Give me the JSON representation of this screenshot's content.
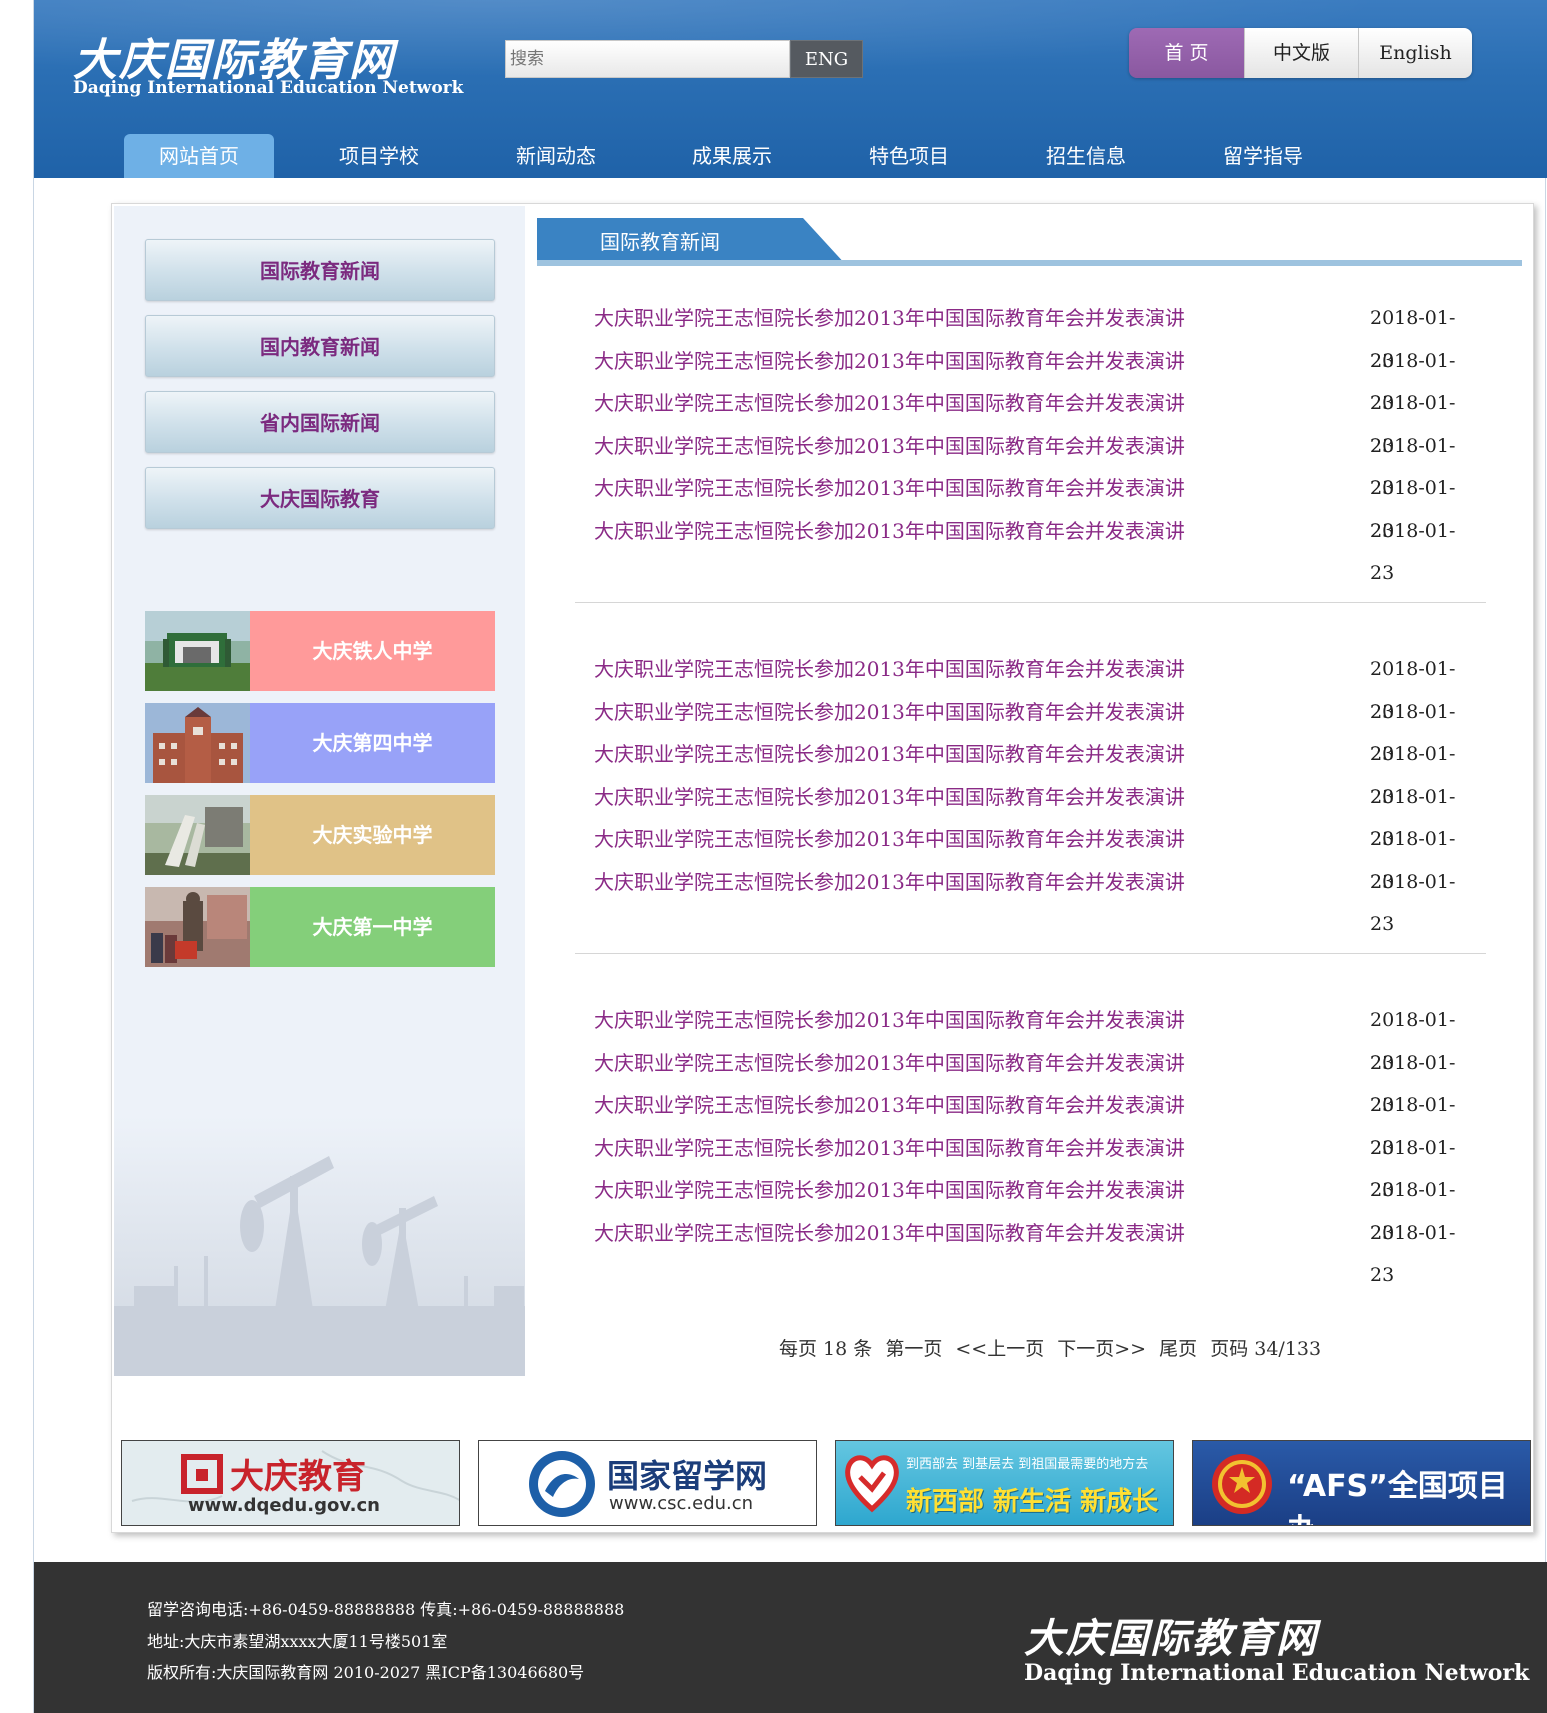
{
  "site": {
    "logo_cn": "大庆国际教育网",
    "logo_en": "Daqing International Education Network"
  },
  "search": {
    "placeholder": "搜索",
    "button": "ENG"
  },
  "lang": {
    "home": "首 页",
    "chinese": "中文版",
    "english": "English"
  },
  "nav": [
    {
      "label": "网站首页",
      "active": true
    },
    {
      "label": "项目学校"
    },
    {
      "label": "新闻动态"
    },
    {
      "label": "成果展示"
    },
    {
      "label": "特色项目"
    },
    {
      "label": "招生信息"
    },
    {
      "label": "留学指导"
    }
  ],
  "sidebar": {
    "categories": [
      "国际教育新闻",
      "国内教育新闻",
      "省内国际新闻",
      "大庆国际教育"
    ],
    "schools": [
      {
        "name": "大庆铁人中学",
        "color": "#ff9a9a"
      },
      {
        "name": "大庆第四中学",
        "color": "#98a2f8"
      },
      {
        "name": "大庆实验中学",
        "color": "#e0c287"
      },
      {
        "name": "大庆第一中学",
        "color": "#84cf7a"
      }
    ]
  },
  "section": {
    "title": "国际教育新闻"
  },
  "news": [
    [
      {
        "title": "大庆职业学院王志恒院长参加2013年中国国际教育年会并发表演讲",
        "date": "2018-01-23"
      },
      {
        "title": "大庆职业学院王志恒院长参加2013年中国国际教育年会并发表演讲",
        "date": "2018-01-23"
      },
      {
        "title": "大庆职业学院王志恒院长参加2013年中国国际教育年会并发表演讲",
        "date": "2018-01-23"
      },
      {
        "title": "大庆职业学院王志恒院长参加2013年中国国际教育年会并发表演讲",
        "date": "2018-01-23"
      },
      {
        "title": "大庆职业学院王志恒院长参加2013年中国国际教育年会并发表演讲",
        "date": "2018-01-23"
      },
      {
        "title": "大庆职业学院王志恒院长参加2013年中国国际教育年会并发表演讲",
        "date": "2018-01-23"
      }
    ],
    [
      {
        "title": "大庆职业学院王志恒院长参加2013年中国国际教育年会并发表演讲",
        "date": "2018-01-23"
      },
      {
        "title": "大庆职业学院王志恒院长参加2013年中国国际教育年会并发表演讲",
        "date": "2018-01-23"
      },
      {
        "title": "大庆职业学院王志恒院长参加2013年中国国际教育年会并发表演讲",
        "date": "2018-01-23"
      },
      {
        "title": "大庆职业学院王志恒院长参加2013年中国国际教育年会并发表演讲",
        "date": "2018-01-23"
      },
      {
        "title": "大庆职业学院王志恒院长参加2013年中国国际教育年会并发表演讲",
        "date": "2018-01-23"
      },
      {
        "title": "大庆职业学院王志恒院长参加2013年中国国际教育年会并发表演讲",
        "date": "2018-01-23"
      }
    ],
    [
      {
        "title": "大庆职业学院王志恒院长参加2013年中国国际教育年会并发表演讲",
        "date": "2018-01-23"
      },
      {
        "title": "大庆职业学院王志恒院长参加2013年中国国际教育年会并发表演讲",
        "date": "2018-01-23"
      },
      {
        "title": "大庆职业学院王志恒院长参加2013年中国国际教育年会并发表演讲",
        "date": "2018-01-23"
      },
      {
        "title": "大庆职业学院王志恒院长参加2013年中国国际教育年会并发表演讲",
        "date": "2018-01-23"
      },
      {
        "title": "大庆职业学院王志恒院长参加2013年中国国际教育年会并发表演讲",
        "date": "2018-01-23"
      },
      {
        "title": "大庆职业学院王志恒院长参加2013年中国国际教育年会并发表演讲",
        "date": "2018-01-23"
      }
    ]
  ],
  "pager": {
    "per_page": "每页 18 条",
    "first": "第一页",
    "prev": "<<上一页",
    "next": "下一页>>",
    "last": "尾页",
    "page_info": "页码 34/133"
  },
  "banners": [
    {
      "title": "大庆教育",
      "url": "www.dqedu.gov.cn"
    },
    {
      "title": "国家留学网",
      "url": "www.csc.edu.cn"
    },
    {
      "title": "新西部 新生活 新成长",
      "slogan": "到西部去 到基层去 到祖国最需要的地方去"
    },
    {
      "title": "“AFS”全国项目办"
    }
  ],
  "footer": {
    "phone": "留学咨询电话:+86-0459-88888888 传真:+86-0459-88888888",
    "address": "地址:大庆市素望湖xxxx大厦11号楼501室",
    "copyright": "版权所有:大庆国际教育网 2010-2027 黑ICP备13046680号",
    "logo_cn": "大庆国际教育网",
    "logo_en": "Daqing International Education Network"
  }
}
